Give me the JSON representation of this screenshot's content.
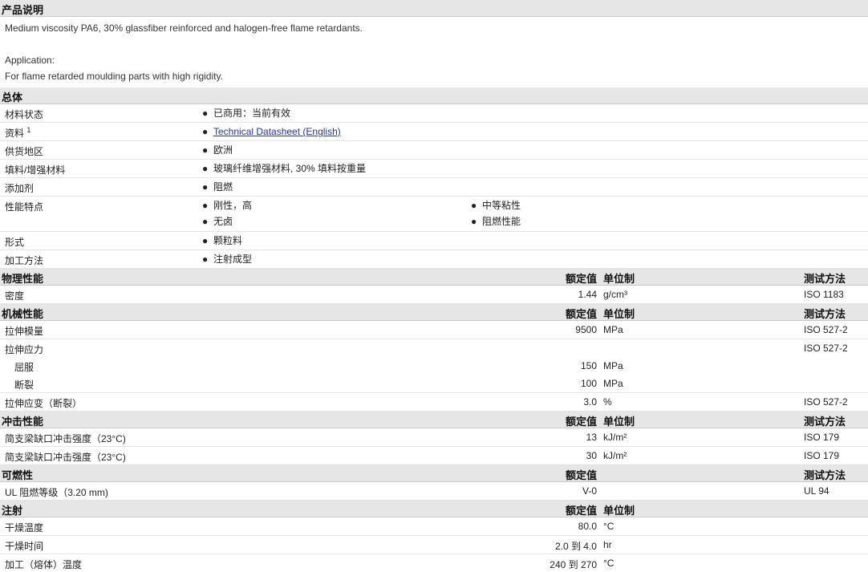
{
  "sections": {
    "description": {
      "title": "产品说明"
    },
    "general": {
      "title": "总体"
    },
    "physical": {
      "title": "物理性能",
      "nominal": "额定值",
      "unit": "单位制",
      "method": "测试方法"
    },
    "mechanical": {
      "title": "机械性能",
      "nominal": "额定值",
      "unit": "单位制",
      "method": "测试方法"
    },
    "impact": {
      "title": "冲击性能",
      "nominal": "额定值",
      "unit": "单位制",
      "method": "测试方法"
    },
    "flammability": {
      "title": "可燃性",
      "nominal": "额定值",
      "method": "测试方法"
    },
    "injection": {
      "title": "注射",
      "nominal": "额定值",
      "unit": "单位制"
    }
  },
  "description": {
    "line1": "Medium viscosity PA6, 30% glassfiber reinforced and halogen-free flame retardants.",
    "line2": "Application:",
    "line3": "For flame retarded moulding parts with high rigidity."
  },
  "bullet": "●",
  "general": {
    "status": {
      "label": "材料状态",
      "value": "已商用：当前有效"
    },
    "docs": {
      "label": "资料",
      "sup": "1",
      "link": "Technical Datasheet (English)"
    },
    "region": {
      "label": "供货地区",
      "value": "欧洲"
    },
    "filler": {
      "label": "填料/增强材料",
      "value": "玻璃纤维增强材料, 30% 填料按重量"
    },
    "additive": {
      "label": "添加剂",
      "value": "阻燃"
    },
    "features": {
      "label": "性能特点",
      "items": [
        "刚性，高",
        "中等粘性",
        "无卤",
        "阻燃性能"
      ]
    },
    "form": {
      "label": "形式",
      "value": "颗粒料"
    },
    "processing": {
      "label": "加工方法",
      "value": "注射成型"
    }
  },
  "physical": {
    "density": {
      "label": "密度",
      "value": "1.44",
      "unit": "g/cm³",
      "method": "ISO 1183"
    }
  },
  "mechanical": {
    "modulus": {
      "label": "拉伸模量",
      "value": "9500",
      "unit": "MPa",
      "method": "ISO 527-2"
    },
    "stress": {
      "label": "拉伸应力",
      "method": "ISO 527-2"
    },
    "yield": {
      "label": "屈服",
      "value": "150",
      "unit": "MPa"
    },
    "break": {
      "label": "断裂",
      "value": "100",
      "unit": "MPa"
    },
    "strain": {
      "label": "拉伸应变（断裂）",
      "value": "3.0",
      "unit": "%",
      "method": "ISO 527-2"
    }
  },
  "impact": {
    "charpy_notched": {
      "label": "简支梁缺口冲击强度（23°C)",
      "value": "13",
      "unit": "kJ/m²",
      "method": "ISO 179"
    },
    "charpy_unnotched": {
      "label": "简支梁缺口冲击强度（23°C)",
      "value": "30",
      "unit": "kJ/m²",
      "method": "ISO 179"
    }
  },
  "flammability": {
    "ul": {
      "label": "UL 阻燃等级（3.20 mm)",
      "value": "V-0",
      "method": "UL 94"
    }
  },
  "injection": {
    "drying_temp": {
      "label": "干燥温度",
      "value": "80.0",
      "unit": "°C"
    },
    "drying_time": {
      "label": "干燥时间",
      "value": "2.0 到 4.0",
      "unit": "hr"
    },
    "melt_temp": {
      "label": "加工（熔体）温度",
      "value": "240 到 270",
      "unit": "°C"
    }
  }
}
